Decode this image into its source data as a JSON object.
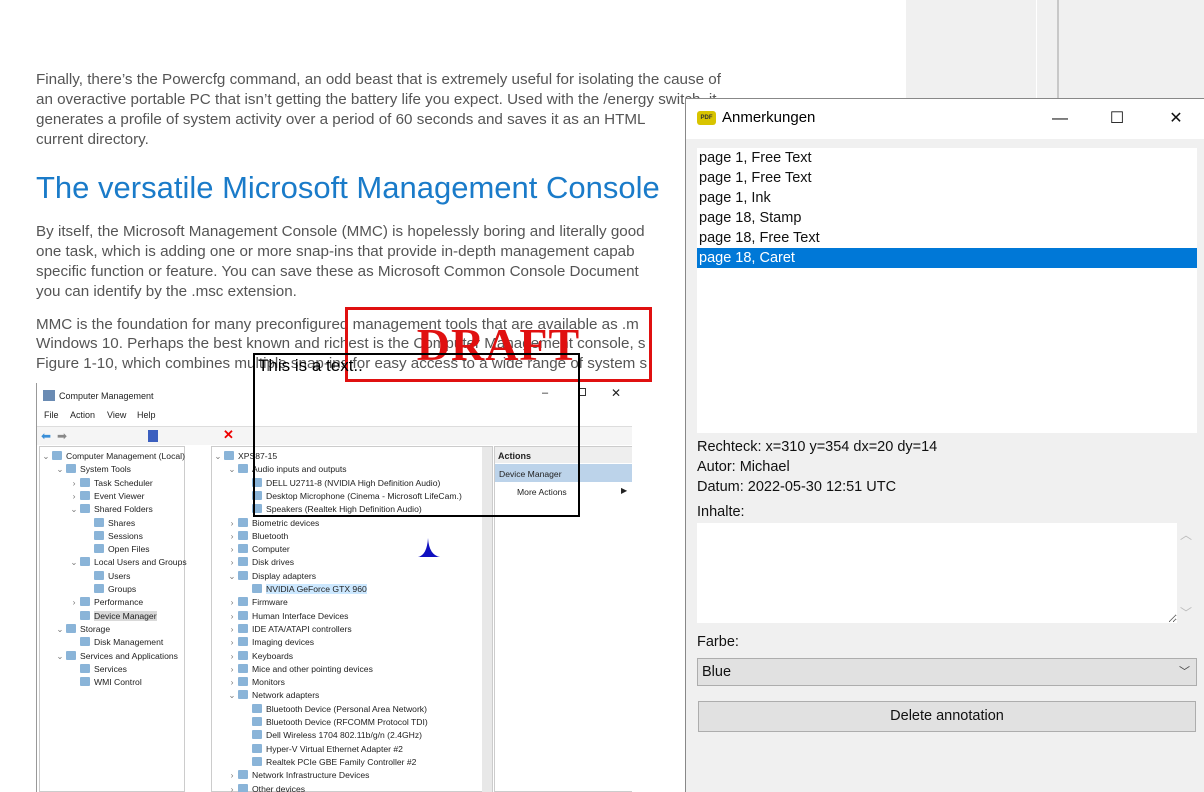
{
  "document": {
    "para1": [
      "Finally, there’s the Powercfg command, an odd beast that is extremely useful for isolating the cause of",
      "an overactive portable PC that isn’t getting the battery life you expect. Used with the /energy switch, it",
      "generates a profile of system activity over a period of 60 seconds and saves it as an HTML",
      "current directory."
    ],
    "heading": "The versatile Microsoft Management Console",
    "para2": [
      "By itself, the Microsoft Management Console (MMC) is hopelessly boring and literally good",
      "one task, which is adding one or more snap-ins that provide in-depth management capab",
      "specific function or feature. You can save these as Microsoft Common Console Document",
      "you can identify by the .msc extension."
    ],
    "para3": [
      "MMC is the foundation for many preconfigured management tools that are available as .m",
      "Windows 10. Perhaps the best known and richest is the Computer Management console, s",
      "Figure 1-10, which combines multiple snap-ins for easy access to a wide range of system s"
    ],
    "figure": {
      "title": "Computer Management",
      "menu": [
        "File",
        "Action",
        "View",
        "Help"
      ],
      "left_tree": [
        {
          "l": 0,
          "e": "v",
          "t": "Computer Management (Local)"
        },
        {
          "l": 1,
          "e": "v",
          "t": "System Tools"
        },
        {
          "l": 2,
          "e": ">",
          "t": "Task Scheduler"
        },
        {
          "l": 2,
          "e": ">",
          "t": "Event Viewer"
        },
        {
          "l": 2,
          "e": "v",
          "t": "Shared Folders"
        },
        {
          "l": 3,
          "e": "",
          "t": "Shares"
        },
        {
          "l": 3,
          "e": "",
          "t": "Sessions"
        },
        {
          "l": 3,
          "e": "",
          "t": "Open Files"
        },
        {
          "l": 2,
          "e": "v",
          "t": "Local Users and Groups"
        },
        {
          "l": 3,
          "e": "",
          "t": "Users"
        },
        {
          "l": 3,
          "e": "",
          "t": "Groups"
        },
        {
          "l": 2,
          "e": ">",
          "t": "Performance"
        },
        {
          "l": 2,
          "e": "",
          "t": "Device Manager",
          "sel": true
        },
        {
          "l": 1,
          "e": "v",
          "t": "Storage"
        },
        {
          "l": 2,
          "e": "",
          "t": "Disk Management"
        },
        {
          "l": 1,
          "e": "v",
          "t": "Services and Applications"
        },
        {
          "l": 2,
          "e": "",
          "t": "Services"
        },
        {
          "l": 2,
          "e": "",
          "t": "WMI Control"
        }
      ],
      "device_tree": [
        {
          "l": 0,
          "e": "v",
          "t": "XPS87-15"
        },
        {
          "l": 1,
          "e": "v",
          "t": "Audio inputs and outputs"
        },
        {
          "l": 2,
          "e": "",
          "t": "DELL U2711-8 (NVIDIA High Definition Audio)"
        },
        {
          "l": 2,
          "e": "",
          "t": "Desktop Microphone (Cinema - Microsoft LifeCam.)"
        },
        {
          "l": 2,
          "e": "",
          "t": "Speakers (Realtek High Definition Audio)"
        },
        {
          "l": 1,
          "e": ">",
          "t": "Biometric devices"
        },
        {
          "l": 1,
          "e": ">",
          "t": "Bluetooth"
        },
        {
          "l": 1,
          "e": ">",
          "t": "Computer"
        },
        {
          "l": 1,
          "e": ">",
          "t": "Disk drives"
        },
        {
          "l": 1,
          "e": "v",
          "t": "Display adapters"
        },
        {
          "l": 2,
          "e": "",
          "t": "NVIDIA GeForce GTX 960",
          "hl": true
        },
        {
          "l": 1,
          "e": ">",
          "t": "Firmware"
        },
        {
          "l": 1,
          "e": ">",
          "t": "Human Interface Devices"
        },
        {
          "l": 1,
          "e": ">",
          "t": "IDE ATA/ATAPI controllers"
        },
        {
          "l": 1,
          "e": ">",
          "t": "Imaging devices"
        },
        {
          "l": 1,
          "e": ">",
          "t": "Keyboards"
        },
        {
          "l": 1,
          "e": ">",
          "t": "Mice and other pointing devices"
        },
        {
          "l": 1,
          "e": ">",
          "t": "Monitors"
        },
        {
          "l": 1,
          "e": "v",
          "t": "Network adapters"
        },
        {
          "l": 2,
          "e": "",
          "t": "Bluetooth Device (Personal Area Network)"
        },
        {
          "l": 2,
          "e": "",
          "t": "Bluetooth Device (RFCOMM Protocol TDI)"
        },
        {
          "l": 2,
          "e": "",
          "t": "Dell Wireless 1704 802.11b/g/n (2.4GHz)"
        },
        {
          "l": 2,
          "e": "",
          "t": "Hyper-V Virtual Ethernet Adapter #2"
        },
        {
          "l": 2,
          "e": "",
          "t": "Realtek PCIe GBE Family Controller #2"
        },
        {
          "l": 1,
          "e": ">",
          "t": "Network Infrastructure Devices"
        },
        {
          "l": 1,
          "e": ">",
          "t": "Other devices"
        }
      ],
      "actions": {
        "header": "Actions",
        "section": "Device Manager",
        "more": "More Actions"
      }
    },
    "annotations": {
      "free_text": "This is a text..",
      "stamp": "DRAFT",
      "stamp_color": "#e01010",
      "caret_color": "#1010c0"
    }
  },
  "dialog": {
    "title": "Anmerkungen",
    "icon": "pdf-app-icon",
    "icon_text": "PDF",
    "list": [
      "page 1, Free Text",
      "page 1, Free Text",
      "page 1, Ink",
      "page 18, Stamp",
      "page 18, Free Text",
      "page 18, Caret"
    ],
    "selected_index": 5,
    "rect": "Rechteck: x=310 y=354 dx=20 dy=14",
    "author": "Autor: Michael",
    "date": "Datum: 2022-05-30 12:51 UTC",
    "contents_label": "Inhalte:",
    "contents_value": "",
    "color_label": "Farbe:",
    "color_value": "Blue",
    "delete_label": "Delete annotation",
    "accent": "#0078d7"
  }
}
